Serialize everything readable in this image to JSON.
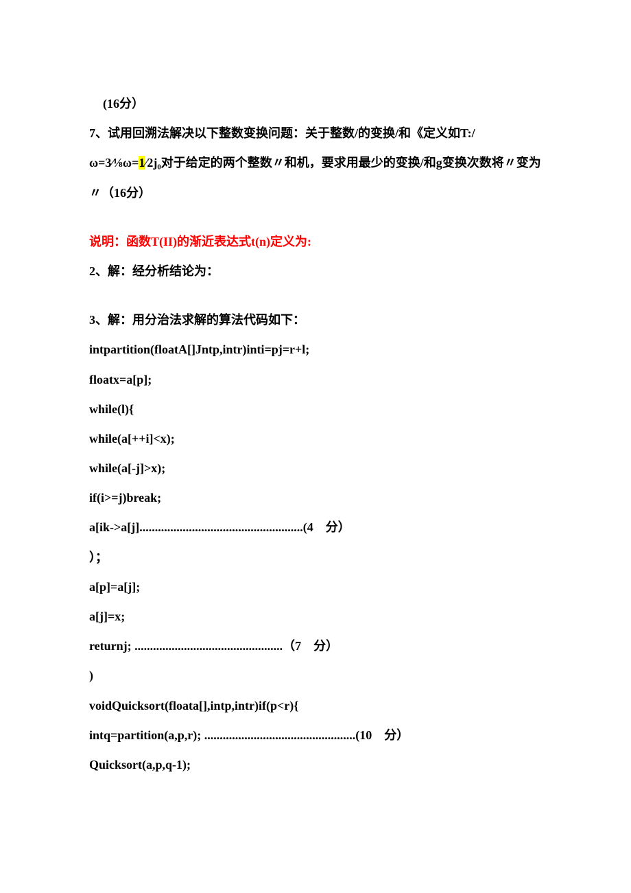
{
  "content": {
    "l1": "(16分）",
    "l2_pre": "7、试用回溯法解决以下整数变换问题：关于整数/的变换/和《定义如T:/ω=3⁄⅛ω=",
    "l2_hl": "1",
    "l2_post": "∕2j₀对于给定的两个整数〃和机，要求用最少的变换/和g变换次数将〃变为〃（16分）",
    "l3": "说明：函数T(II)的渐近表达式t(n)定义为:",
    "l4": "2、解：经分析结论为：",
    "l5": "3、解：用分治法求解的算法代码如下：",
    "l6": "intpartition(floatA[]Jntp,intr)inti=pj=r+l;",
    "l7": "floatx=a[p];",
    "l8": "while(l){",
    "l9": "while(a[++i]<x);",
    "l10": "while(a[-j]>x);",
    "l11": "if(i>=j)break;",
    "l12": "a[ik->a[j].....................................................(4　分）",
    "l13": "）；",
    "l14": "a[p]=a[j];",
    "l15": "a[j]=x;",
    "l16": "returnj; ................................................（7　分）",
    "l17": ")",
    "l18": "voidQuicksort(floata[],intp,intr)if(p<r){",
    "l19": "intq=partition(a,p,r); .................................................(10　分）",
    "l20": "Quicksort(a,p,q-1);"
  }
}
